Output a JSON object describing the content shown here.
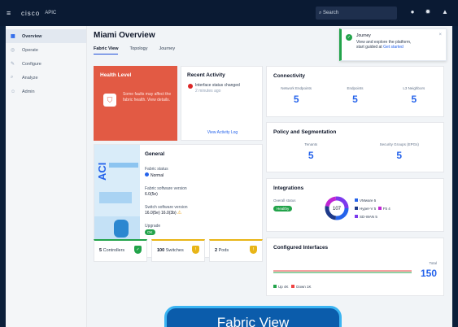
{
  "topbar": {
    "menu_icon": "menu-icon",
    "logo": "cisco",
    "app_name": "APIC",
    "search_placeholder": "Search",
    "icons": [
      "help-icon",
      "settings-icon",
      "user-icon"
    ]
  },
  "sidebar": {
    "items": [
      {
        "label": "Overview",
        "icon": "dashboard-icon",
        "active": true
      },
      {
        "label": "Operate",
        "icon": "operate-icon",
        "active": false
      },
      {
        "label": "Configure",
        "icon": "wrench-icon",
        "active": false
      },
      {
        "label": "Analyze",
        "icon": "magnify-icon",
        "active": false
      },
      {
        "label": "Admin",
        "icon": "users-icon",
        "active": false
      }
    ]
  },
  "page": {
    "title": "Miami Overview",
    "tabs": [
      {
        "label": "Fabric View",
        "active": true
      },
      {
        "label": "Topology",
        "active": false
      },
      {
        "label": "Journey",
        "active": false
      }
    ]
  },
  "toast": {
    "title": "Journey",
    "body": "View and explore the platform,",
    "body2": "start guided at",
    "link": "Get started"
  },
  "health": {
    "title": "Health Level",
    "message": "Some faults may affect the fabric health. View details."
  },
  "recent": {
    "title": "Recent Activity",
    "item_title": "Interface status changed",
    "item_sub": "2 minutes ago",
    "view_all": "View Activity Log"
  },
  "general": {
    "title": "General",
    "art_text": "ACI",
    "fields": [
      {
        "label": "Fabric status",
        "value": "Normal"
      },
      {
        "label": "Fabric software version",
        "value": "6.0(5e)"
      },
      {
        "label": "Switch software version",
        "value": "16.0(5e) 16.0(3b)"
      },
      {
        "label": "Upgrade",
        "value": "OK"
      }
    ]
  },
  "stats": [
    {
      "value": "5",
      "label": "Controllers",
      "status": "green"
    },
    {
      "value": "100",
      "label": "Switches",
      "status": "yellow"
    },
    {
      "value": "2",
      "label": "Pods",
      "status": "yellow"
    }
  ],
  "connectivity": {
    "title": "Connectivity",
    "metrics": [
      {
        "label": "Network Endpoints",
        "value": "5"
      },
      {
        "label": "Endpoints",
        "value": "5"
      },
      {
        "label": "L3 Neighbors",
        "value": "5"
      }
    ]
  },
  "policy": {
    "title": "Policy and Segmentation",
    "metrics": [
      {
        "label": "Tenants",
        "value": "5"
      },
      {
        "label": "Security Groups (EPGs)",
        "value": "5"
      }
    ]
  },
  "integrations": {
    "title": "Integrations",
    "status_label": "Overall status",
    "status_value": "Healthy",
    "donut_value": "107",
    "legend": [
      {
        "label": "VMware 5",
        "color": "#2563eb"
      },
      {
        "label": "Hyper-V 5",
        "color": "#1e3a8a"
      },
      {
        "label": "F5 4",
        "color": "#c026d3"
      },
      {
        "label": "SD-WAN 5",
        "color": "#7c3aed"
      }
    ]
  },
  "interfaces": {
    "title": "Configured Interfaces",
    "caption": "Total",
    "count": "150",
    "legend_up": "Up 4K",
    "legend_down": "Down 1K"
  },
  "banner": {
    "label": "Fabric View"
  }
}
